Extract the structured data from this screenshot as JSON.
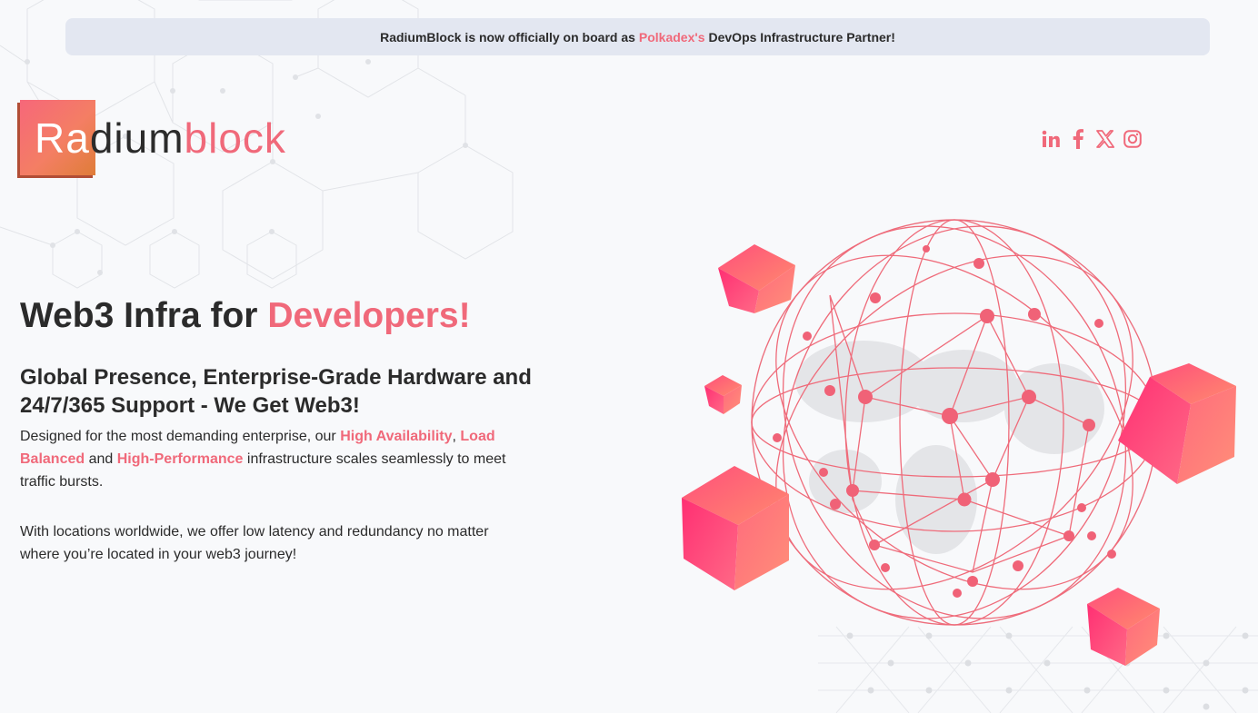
{
  "banner": {
    "prefix": "RadiumBlock is now officially on board as",
    "link": "Polkadex's",
    "suffix": "DevOps Infrastructure Partner!"
  },
  "logo": {
    "part1": "Ra",
    "part2": "dium",
    "part3": "block"
  },
  "socials": [
    {
      "name": "linkedin-icon"
    },
    {
      "name": "facebook-icon"
    },
    {
      "name": "x-icon"
    },
    {
      "name": "instagram-icon"
    }
  ],
  "hero": {
    "title_prefix": "Web3 Infra for",
    "title_accent": "Developers!",
    "subtitle": "Global Presence, Enterprise-Grade Hardware and 24/7/365 Support - We Get Web3!",
    "p1_a": "Designed for the most demanding enterprise, our",
    "p1_hl1": "High Availability",
    "p1_sep": ",",
    "p1_hl2": "Load Balanced",
    "p1_and": "and",
    "p1_hl3": "High-Performance",
    "p1_b": "infrastructure scales seamlessly to meet traffic bursts.",
    "p2": "With locations worldwide, we offer low latency and redundancy no matter where you’re located in your web3 journey!"
  },
  "colors": {
    "accent": "#f0697a",
    "text": "#2b2b2b",
    "banner_bg": "#e3e7f1",
    "page_bg": "#f8f9fb"
  }
}
